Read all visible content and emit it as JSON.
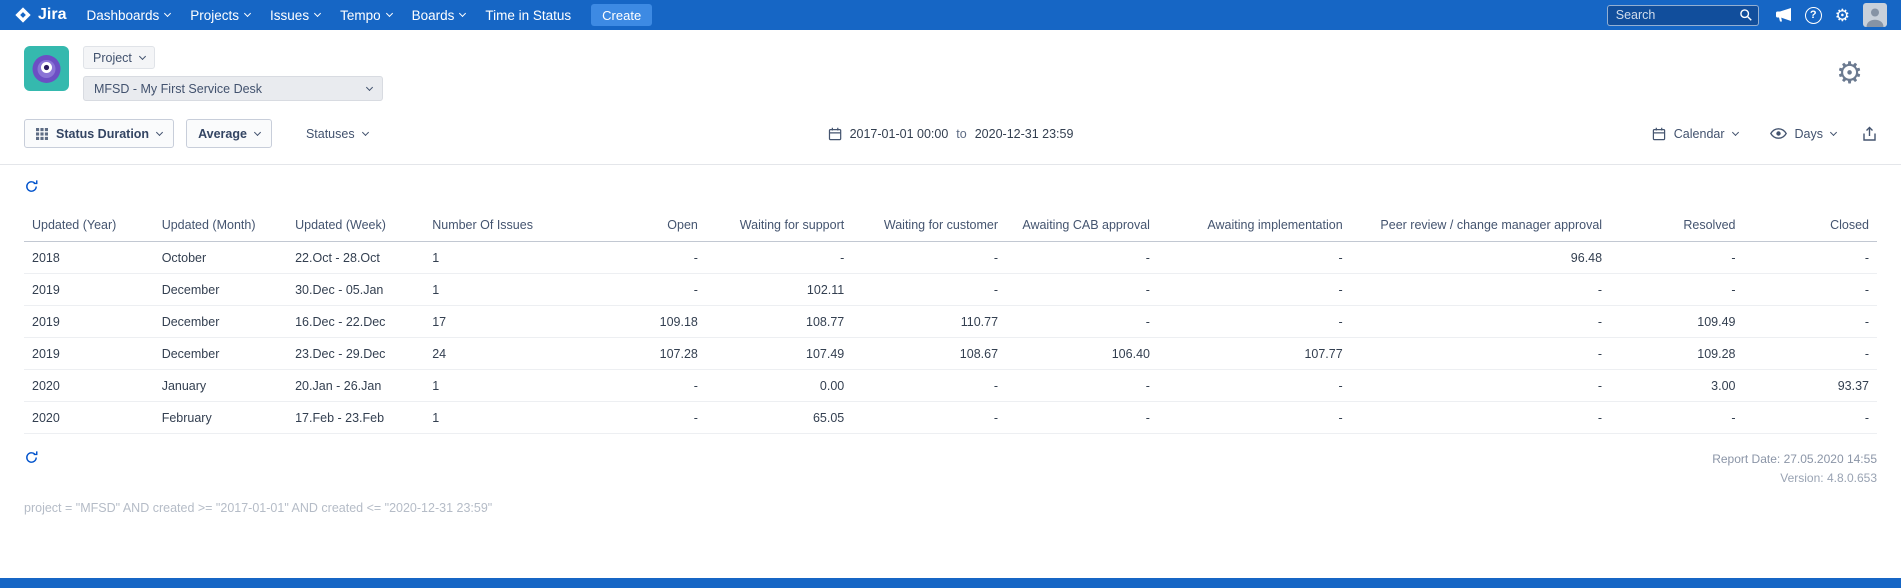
{
  "colors": {
    "navbar_blue": "#1666C5",
    "create_blue": "#3D8AE3",
    "link_blue": "#0052CC",
    "avatar_teal": "#35B9AE",
    "monster_purple": "#6C4FC4"
  },
  "navbar": {
    "brand": "Jira",
    "items": [
      {
        "id": "dashboards",
        "label": "Dashboards",
        "caret": true
      },
      {
        "id": "projects",
        "label": "Projects",
        "caret": true
      },
      {
        "id": "issues",
        "label": "Issues",
        "caret": true
      },
      {
        "id": "tempo",
        "label": "Tempo",
        "caret": true
      },
      {
        "id": "boards",
        "label": "Boards",
        "caret": true
      },
      {
        "id": "time-in-status",
        "label": "Time in Status",
        "caret": false
      }
    ],
    "create_label": "Create",
    "search_placeholder": "Search"
  },
  "project_header": {
    "project_button": "Project",
    "project_select": "MFSD - My First Service Desk"
  },
  "toolbar": {
    "report_type": "Status Duration",
    "metric": "Average",
    "statuses": "Statuses",
    "date_from": "2017-01-01 00:00",
    "to_label": "to",
    "date_to": "2020-12-31 23:59",
    "calendar_label": "Calendar",
    "unit_label": "Days"
  },
  "table": {
    "columns": [
      {
        "label": "Updated (Year)",
        "align": "left"
      },
      {
        "label": "Updated (Month)",
        "align": "left"
      },
      {
        "label": "Updated (Week)",
        "align": "left"
      },
      {
        "label": "Number Of Issues",
        "align": "left"
      },
      {
        "label": "Open",
        "align": "right"
      },
      {
        "label": "Waiting for support",
        "align": "right"
      },
      {
        "label": "Waiting for customer",
        "align": "right"
      },
      {
        "label": "Awaiting CAB approval",
        "align": "right"
      },
      {
        "label": "Awaiting implementation",
        "align": "right"
      },
      {
        "label": "Peer review / change manager approval",
        "align": "right"
      },
      {
        "label": "Resolved",
        "align": "right"
      },
      {
        "label": "Closed",
        "align": "right"
      }
    ],
    "rows": [
      [
        "2018",
        "October",
        "22.Oct - 28.Oct",
        "1",
        "-",
        "-",
        "-",
        "-",
        "-",
        "96.48",
        "-",
        "-"
      ],
      [
        "2019",
        "December",
        "30.Dec - 05.Jan",
        "1",
        "-",
        "102.11",
        "-",
        "-",
        "-",
        "-",
        "-",
        "-"
      ],
      [
        "2019",
        "December",
        "16.Dec - 22.Dec",
        "17",
        "109.18",
        "108.77",
        "110.77",
        "-",
        "-",
        "-",
        "109.49",
        "-"
      ],
      [
        "2019",
        "December",
        "23.Dec - 29.Dec",
        "24",
        "107.28",
        "107.49",
        "108.67",
        "106.40",
        "107.77",
        "-",
        "109.28",
        "-"
      ],
      [
        "2020",
        "January",
        "20.Jan - 26.Jan",
        "1",
        "-",
        "0.00",
        "-",
        "-",
        "-",
        "-",
        "3.00",
        "93.37"
      ],
      [
        "2020",
        "February",
        "17.Feb - 23.Feb",
        "1",
        "-",
        "65.05",
        "-",
        "-",
        "-",
        "-",
        "-",
        "-"
      ]
    ]
  },
  "footer": {
    "report_date": "Report Date: 27.05.2020 14:55",
    "version": "Version: 4.8.0.653",
    "jql": "project = \"MFSD\" AND created >= \"2017-01-01\" AND created <= \"2020-12-31 23:59\""
  }
}
